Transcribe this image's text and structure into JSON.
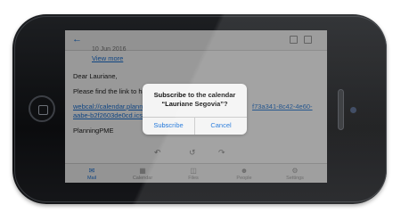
{
  "email": {
    "date": "10 Jun 2016",
    "view_more": "View more",
    "greeting": "Dear Lauriane,",
    "intro": "Please find the link to have",
    "link_line1": "webcal://calendar.planning",
    "link_line1_tail": "f73a341-8c42-4e60-",
    "link_line2": "aabe-b2f2603de0cd.ics",
    "signature": "PlanningPME"
  },
  "dialog": {
    "title_line1": "Subscribe to the calendar",
    "title_line2": "“Lauriane Segovia”?",
    "subscribe_label": "Subscribe",
    "cancel_label": "Cancel"
  },
  "tabs": [
    {
      "label": "Mail",
      "icon": "mail-icon"
    },
    {
      "label": "Calendar",
      "icon": "calendar-icon"
    },
    {
      "label": "Files",
      "icon": "files-icon"
    },
    {
      "label": "People",
      "icon": "people-icon"
    },
    {
      "label": "Settings",
      "icon": "settings-icon"
    }
  ],
  "colors": {
    "accent": "#1a73d9"
  }
}
